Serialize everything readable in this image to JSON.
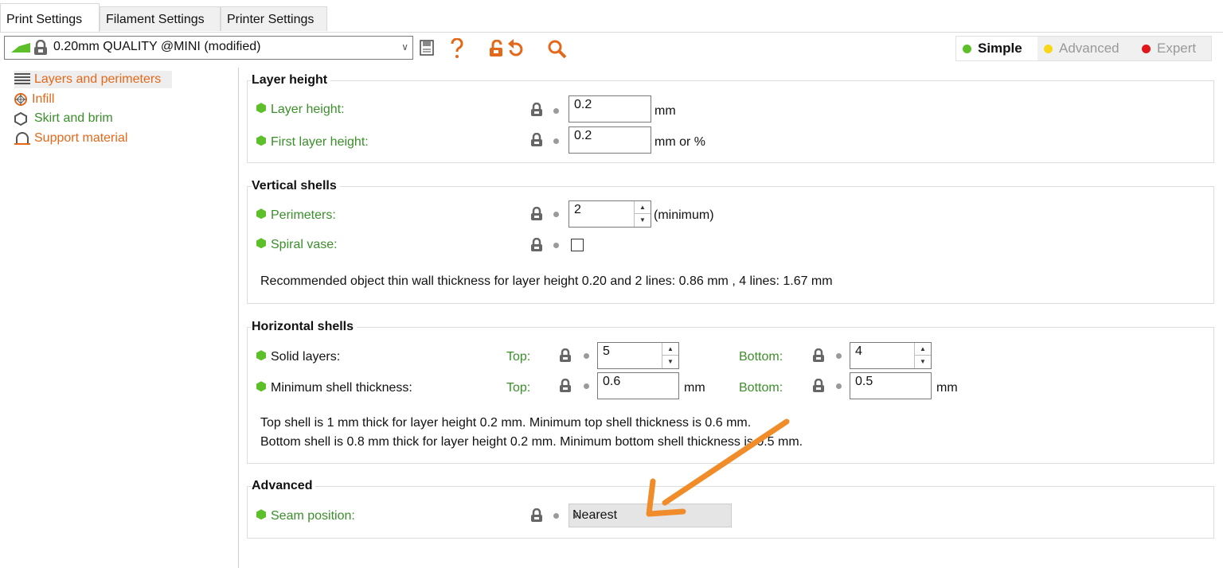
{
  "tabs": [
    {
      "label": "Print Settings",
      "active": true
    },
    {
      "label": "Filament Settings",
      "active": false
    },
    {
      "label": "Printer Settings",
      "active": false
    }
  ],
  "toolbar": {
    "preset_value": "0.20mm QUALITY @MINI (modified)",
    "icons": [
      "flag-icon",
      "lock-icon",
      "save-icon",
      "question-icon",
      "unlock-icon",
      "undo-icon",
      "search-icon"
    ],
    "modes": [
      {
        "label": "Simple",
        "color": "#5dbf2a",
        "active": true
      },
      {
        "label": "Advanced",
        "color": "#f6d71a",
        "active": false
      },
      {
        "label": "Expert",
        "color": "#e0161b",
        "active": false
      }
    ]
  },
  "tree": [
    {
      "label": "Layers and perimeters",
      "icon": "layers-icon",
      "color": "#e4681a",
      "selected": true
    },
    {
      "label": "Infill",
      "icon": "infill-icon",
      "color": "#e4681a",
      "selected": false
    },
    {
      "label": "Skirt and brim",
      "icon": "skirt-icon",
      "color": "#3a8f2a",
      "selected": false
    },
    {
      "label": "Support material",
      "icon": "support-icon",
      "color": "#e4681a",
      "selected": false
    }
  ],
  "layer_height": {
    "title": "Layer height",
    "layer_height": {
      "label": "Layer height:",
      "value": "0.2",
      "unit": "mm"
    },
    "first_layer_height": {
      "label": "First layer height:",
      "value": "0.2",
      "unit": "mm or %"
    }
  },
  "vertical_shells": {
    "title": "Vertical shells",
    "perimeters": {
      "label": "Perimeters:",
      "value": "2",
      "unit": "(minimum)"
    },
    "spiral_vase": {
      "label": "Spiral vase:",
      "checked": false
    },
    "note": "Recommended object thin wall thickness for layer height 0.20 and 2 lines: 0.86 mm , 4 lines: 1.67 mm"
  },
  "horizontal_shells": {
    "title": "Horizontal shells",
    "solid_layers": {
      "label": "Solid layers:",
      "top_label": "Top:",
      "top_value": "5",
      "bottom_label": "Bottom:",
      "bottom_value": "4"
    },
    "min_shell": {
      "label": "Minimum shell thickness:",
      "top_label": "Top:",
      "top_value": "0.6",
      "top_unit": "mm",
      "bottom_label": "Bottom:",
      "bottom_value": "0.5",
      "bottom_unit": "mm"
    },
    "note1": "Top shell is 1 mm thick for layer height 0.2 mm. Minimum top shell thickness is 0.6 mm.",
    "note2": "Bottom shell is 0.8 mm thick for layer height 0.2 mm. Minimum bottom shell thickness is 0.5 mm."
  },
  "advanced": {
    "title": "Advanced",
    "seam_position": {
      "label": "Seam position:",
      "value": "Nearest"
    }
  },
  "colors": {
    "orange": "#e4681a",
    "green": "#3a8f2a",
    "arrow": "#f08c2a"
  }
}
